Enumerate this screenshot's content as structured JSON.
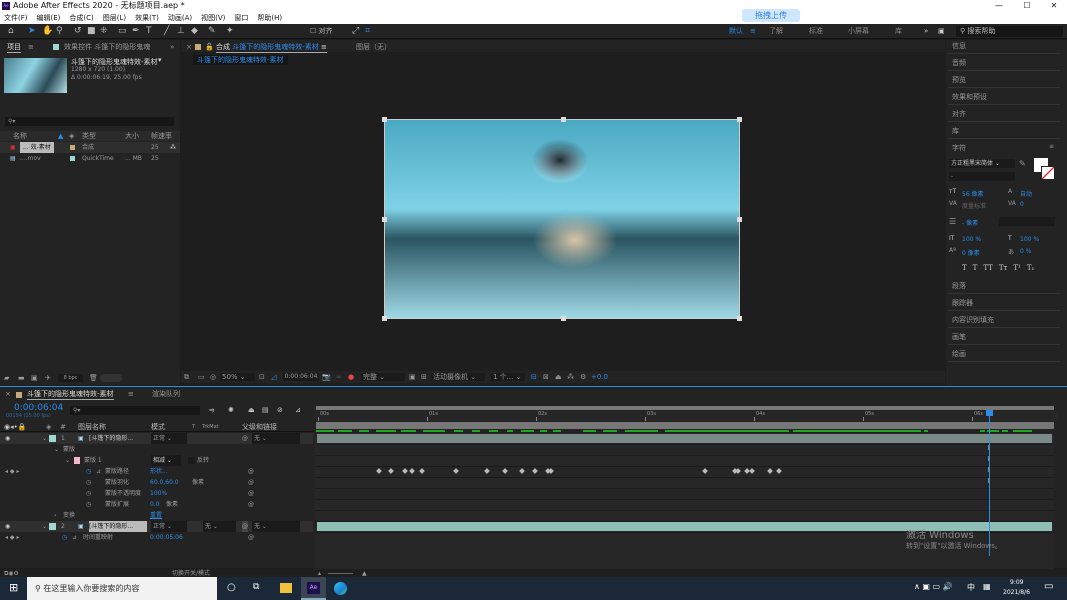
{
  "window": {
    "title": "Adobe After Effects 2020 - 无标题项目.aep *",
    "app_icon": "Ae",
    "upload_button": "拖拽上传",
    "controls": [
      "—",
      "☐",
      "✕"
    ]
  },
  "menu": [
    "文件(F)",
    "编辑(E)",
    "合成(C)",
    "图层(L)",
    "效果(T)",
    "动画(A)",
    "视图(V)",
    "窗口",
    "帮助(H)"
  ],
  "toolbar": {
    "align_label": "对齐",
    "workspaces": [
      "默认",
      "了解",
      "标准",
      "小屏幕",
      "库"
    ],
    "more": "»",
    "search_placeholder": "搜索帮助"
  },
  "project": {
    "tab": "项目",
    "tab2": "效果控件 斗篷下的隐形鬼魂",
    "item_name": "斗篷下的隐形鬼魂特效-素材",
    "resolution": "1280 x 720 (1.00)",
    "duration": "Δ 0:00:06:19, 25.00 fps",
    "columns": [
      "名称",
      "类型",
      "大小",
      "帧速率"
    ],
    "items": [
      {
        "name": "... 效-素材",
        "type": "合成",
        "size": "",
        "fps": "25",
        "color": "#c8a97a"
      },
      {
        "name": "....mov",
        "type": "QuickTime",
        "size": "... MB",
        "fps": "25",
        "color": "#9fd8d0"
      }
    ],
    "bpc": "8 bpc"
  },
  "composition": {
    "close": "×",
    "tab_prefix": "合成",
    "tab_name": "斗篷下的隐形鬼魂特效-素材",
    "layer_tab": "图层（无）",
    "breadcrumb": "斗篷下的隐形鬼魂特效-素材",
    "zoom": "50%",
    "timecode": "0:00:06:04",
    "quality": "完整",
    "camera": "活动摄像机",
    "views": "1 个...",
    "exposure": "+0.0"
  },
  "right_panel": {
    "sections_top": [
      "信息",
      "音频",
      "预览",
      "效果和预设",
      "对齐",
      "库"
    ],
    "character": {
      "title": "字符",
      "font": "方正粗黑宋简体",
      "style": "-",
      "size": "56 像素",
      "leading": "自动",
      "kerning": "度量标准",
      "tracking": "0",
      "stroke": "- 像素",
      "vscale": "100 %",
      "hscale": "100 %",
      "baseline": "0 像素",
      "tsume": "0 %",
      "styles": [
        "T",
        "T",
        "TT",
        "Tт",
        "T¹",
        "T₁"
      ]
    },
    "sections_bottom": [
      "段落",
      "跟踪器",
      "内容识别填充",
      "画笔",
      "绘画"
    ]
  },
  "timeline": {
    "tab": "斗篷下的隐形鬼魂特效-素材",
    "tab2": "渲染队列",
    "timecode": "0:00:06:04",
    "frames": "00154 (25.00 fps)",
    "columns": {
      "num": "#",
      "layer_name": "图层名称",
      "mode": "模式",
      "t": "T",
      "trkmat": "TrkMat",
      "parent": "父级和链接"
    },
    "ruler": [
      "00s",
      "01s",
      "02s",
      "03s",
      "04s",
      "05s",
      "06s"
    ],
    "playhead_seconds": 6.16,
    "layers": [
      {
        "num": "1",
        "name": "[斗篷下的隐形...",
        "mode": "正常",
        "parent": "无"
      },
      {
        "num": "2",
        "name": "[斗篷下的隐形...",
        "mode": "正常",
        "trkmat": "无",
        "parent": "无"
      }
    ],
    "mask_group": "蒙版",
    "mask": "蒙版 1",
    "mask_mode": "相减",
    "invert": "反转",
    "props": [
      {
        "name": "蒙版路径",
        "value": "形状..."
      },
      {
        "name": "蒙版羽化",
        "value": "60.0,60.0",
        "unit": "像素"
      },
      {
        "name": "蒙版不透明度",
        "value": "100%"
      },
      {
        "name": "蒙版扩展",
        "value": "0.0",
        "unit": "像素"
      }
    ],
    "transform": "变换",
    "reset": "重置",
    "time_remap": "时间重映射",
    "time_remap_value": "0:00:05:06",
    "keyframes_seconds": [
      0.56,
      0.67,
      0.8,
      0.86,
      0.95,
      1.27,
      1.55,
      1.72,
      1.87,
      1.99,
      2.11,
      2.14,
      3.55,
      3.83,
      3.85,
      3.94,
      3.98,
      4.15,
      4.23
    ],
    "toggle_label": "切换开关/模式"
  },
  "watermark": {
    "line1": "激活 Windows",
    "line2": "转到\"设置\"以激活 Windows。"
  },
  "taskbar": {
    "search_placeholder": "在这里输入你要搜索的内容",
    "time": "9:09",
    "date": "2021/8/6",
    "ime": "中"
  }
}
